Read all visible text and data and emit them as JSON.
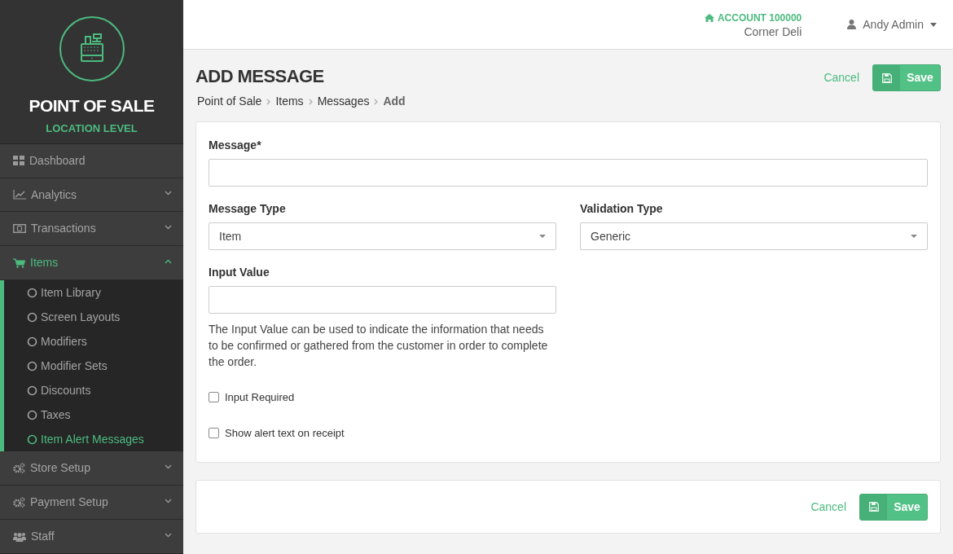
{
  "logo": {
    "title": "POINT OF SALE",
    "subtitle": "LOCATION LEVEL"
  },
  "nav": [
    {
      "label": "Dashboard",
      "selected": false
    },
    {
      "label": "Analytics",
      "expanded": false,
      "selected": false
    },
    {
      "label": "Transactions",
      "expanded": false,
      "selected": false
    },
    {
      "label": "Items",
      "expanded": true,
      "selected": true,
      "children": [
        {
          "label": "Item Library",
          "selected": false
        },
        {
          "label": "Screen Layouts",
          "selected": false
        },
        {
          "label": "Modifiers",
          "selected": false
        },
        {
          "label": "Modifier Sets",
          "selected": false
        },
        {
          "label": "Discounts",
          "selected": false
        },
        {
          "label": "Taxes",
          "selected": false
        },
        {
          "label": "Item Alert Messages",
          "selected": true
        }
      ]
    },
    {
      "label": "Store Setup",
      "expanded": false,
      "selected": false
    },
    {
      "label": "Payment Setup",
      "expanded": false,
      "selected": false
    },
    {
      "label": "Staff",
      "expanded": false,
      "selected": false
    }
  ],
  "header": {
    "account": "ACCOUNT 100000",
    "store": "Corner Deli",
    "user": "Andy Admin"
  },
  "page": {
    "title": "ADD MESSAGE",
    "breadcrumb": [
      "Point of Sale",
      "Items",
      "Messages",
      "Add"
    ],
    "cancel": "Cancel",
    "save": "Save"
  },
  "form": {
    "message": {
      "label": "Message*"
    },
    "message_type": {
      "label": "Message Type",
      "value": "Item"
    },
    "validation_type": {
      "label": "Validation Type",
      "value": "Generic"
    },
    "input_value": {
      "label": "Input Value",
      "help": "The Input Value can be used to indicate the information that needs to be confirmed or gathered from the customer in order to complete the order."
    },
    "checkboxes": [
      {
        "label": "Input Required",
        "checked": false
      },
      {
        "label": "Show alert text on receipt",
        "checked": false
      }
    ]
  },
  "footer": {
    "cancel": "Cancel",
    "save": "Save"
  }
}
